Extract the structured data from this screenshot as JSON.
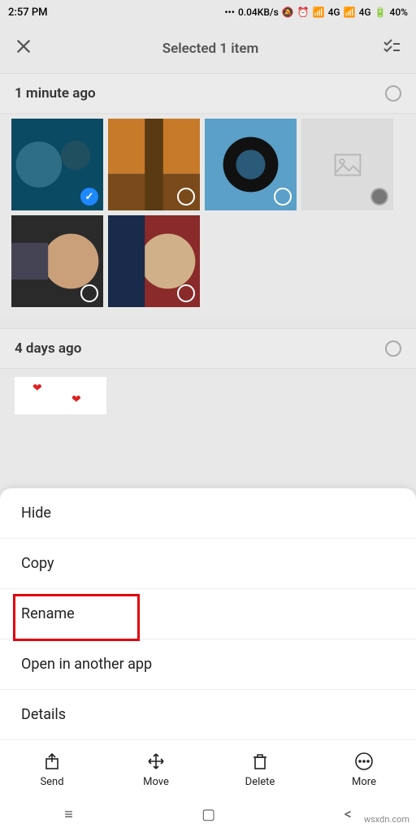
{
  "status": {
    "time": "2:57 PM",
    "speed": "0.04KB/s",
    "net1": "4G",
    "net2": "4G",
    "battery": "40%"
  },
  "header": {
    "title": "Selected 1 item"
  },
  "sections": {
    "first": "1 minute ago",
    "second": "4 days ago"
  },
  "menu": {
    "hide": "Hide",
    "copy": "Copy",
    "rename": "Rename",
    "open": "Open in another app",
    "details": "Details"
  },
  "actions": {
    "send": "Send",
    "move": "Move",
    "delete": "Delete",
    "more": "More"
  },
  "watermark": "wsxdn.com"
}
